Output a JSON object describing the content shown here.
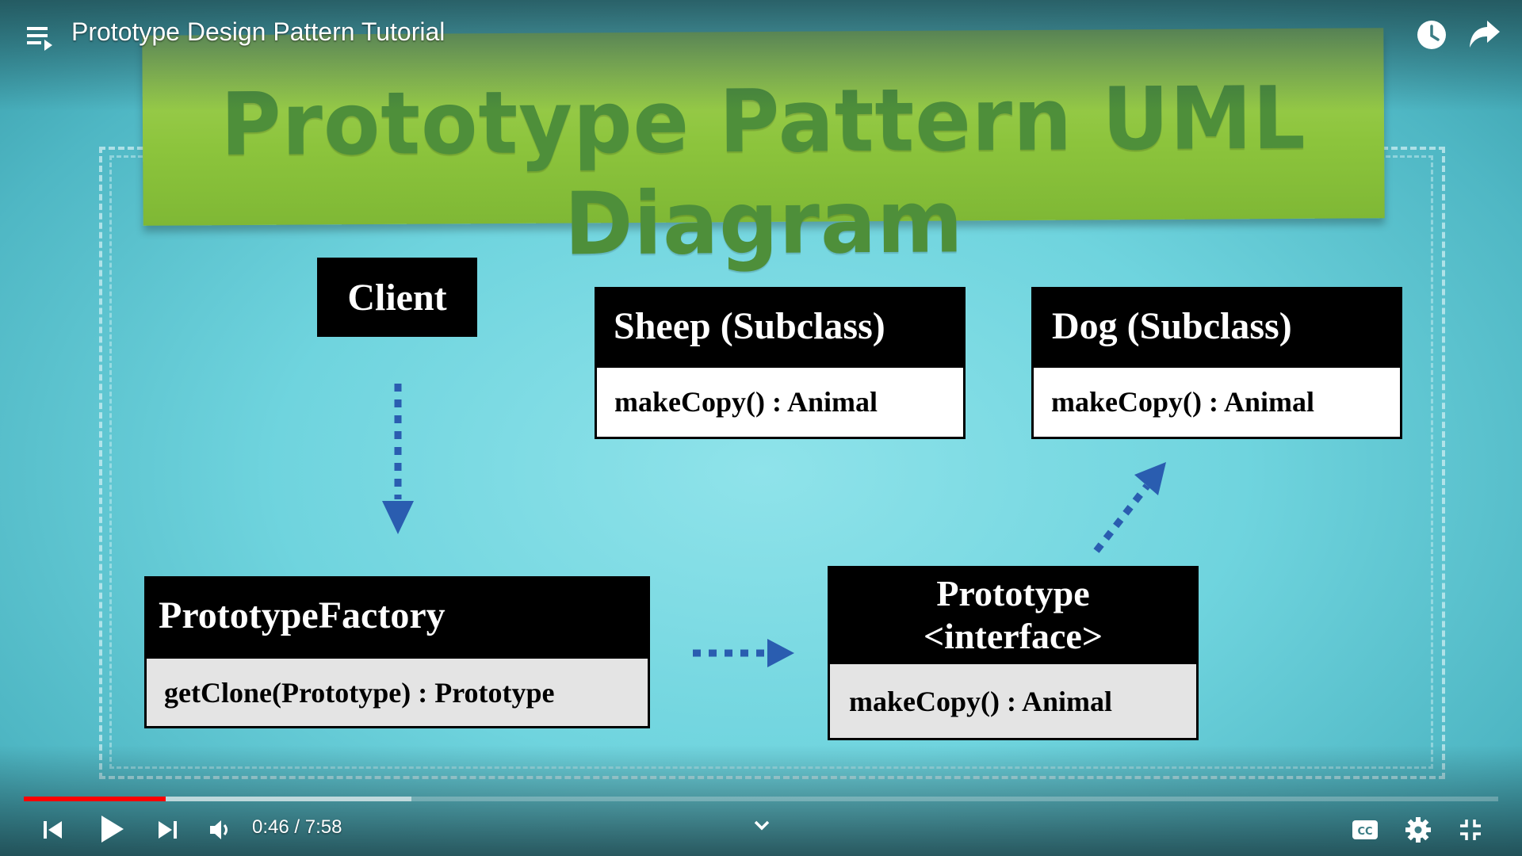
{
  "player": {
    "title": "Prototype Design Pattern Tutorial",
    "time_current": "0:46",
    "time_separator": " / ",
    "time_total": "7:58",
    "progress_played_fraction": 0.0963,
    "progress_buffered_fraction": 0.263,
    "icons": {
      "playlist": "playlist-icon",
      "watch_later": "clock-icon",
      "share": "share-arrow-icon",
      "previous": "skip-previous-icon",
      "play": "play-icon",
      "next": "skip-next-icon",
      "volume": "volume-icon",
      "chevron": "chevron-down-icon",
      "captions": "closed-captions-icon",
      "settings": "gear-icon",
      "exit_fullscreen": "exit-fullscreen-icon"
    },
    "colors": {
      "progress": "#ff0000"
    }
  },
  "slide": {
    "banner_title": "Prototype Pattern UML Diagram",
    "client": {
      "label": "Client"
    },
    "sheep": {
      "name": "Sheep (Subclass)",
      "method": "makeCopy() : Animal"
    },
    "dog": {
      "name": "Dog (Subclass)",
      "method": "makeCopy() : Animal"
    },
    "factory": {
      "name": "PrototypeFactory",
      "method": "getClone(Prototype) : Prototype"
    },
    "prototype": {
      "name_line1": "Prototype",
      "name_line2": "<interface>",
      "method": "makeCopy() : Animal"
    },
    "colors": {
      "background": "#6fd4de",
      "banner": "#8cc43c",
      "banner_text": "#4e8f3a",
      "arrow": "#2a5db0"
    }
  }
}
